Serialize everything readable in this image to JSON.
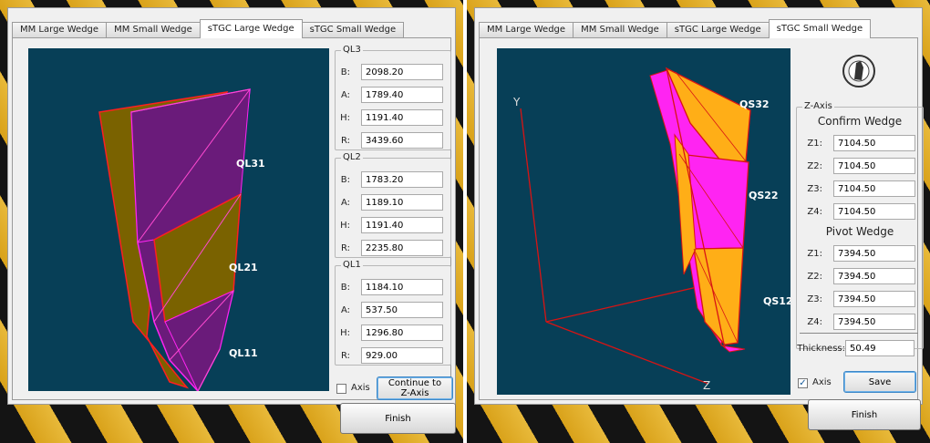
{
  "left": {
    "tabs": [
      "MM Large Wedge",
      "MM Small Wedge",
      "sTGC Large Wedge",
      "sTGC Small Wedge"
    ],
    "active_tab": "sTGC Large Wedge",
    "labels": [
      "QL31",
      "QL21",
      "QL11"
    ],
    "groups": [
      {
        "title": "QL3",
        "fields": [
          {
            "label": "B:",
            "value": "2098.20"
          },
          {
            "label": "A:",
            "value": "1789.40"
          },
          {
            "label": "H:",
            "value": "1191.40"
          },
          {
            "label": "R:",
            "value": "3439.60"
          }
        ]
      },
      {
        "title": "QL2",
        "fields": [
          {
            "label": "B:",
            "value": "1783.20"
          },
          {
            "label": "A:",
            "value": "1189.10"
          },
          {
            "label": "H:",
            "value": "1191.40"
          },
          {
            "label": "R:",
            "value": "2235.80"
          }
        ]
      },
      {
        "title": "QL1",
        "fields": [
          {
            "label": "B:",
            "value": "1184.10"
          },
          {
            "label": "A:",
            "value": "537.50"
          },
          {
            "label": "H:",
            "value": "1296.80"
          },
          {
            "label": "R:",
            "value": "929.00"
          }
        ]
      }
    ],
    "axis_label": "Axis",
    "axis_checked": false,
    "continue_button": "Continue to Z-Axis",
    "finish_button": "Finish"
  },
  "right": {
    "tabs": [
      "MM Large Wedge",
      "MM Small Wedge",
      "sTGC Large Wedge",
      "sTGC Small Wedge"
    ],
    "active_tab": "sTGC Small Wedge",
    "labels": [
      "QS32",
      "QS22",
      "QS12"
    ],
    "axis_letters": {
      "y": "Y",
      "z": "Z"
    },
    "zaxis_title": "Z-Axis",
    "confirm_heading": "Confirm Wedge",
    "confirm_fields": [
      {
        "label": "Z1:",
        "value": "7104.50"
      },
      {
        "label": "Z2:",
        "value": "7104.50"
      },
      {
        "label": "Z3:",
        "value": "7104.50"
      },
      {
        "label": "Z4:",
        "value": "7104.50"
      }
    ],
    "pivot_heading": "Pivot Wedge",
    "pivot_fields": [
      {
        "label": "Z1:",
        "value": "7394.50"
      },
      {
        "label": "Z2:",
        "value": "7394.50"
      },
      {
        "label": "Z3:",
        "value": "7394.50"
      },
      {
        "label": "Z4:",
        "value": "7394.50"
      }
    ],
    "thickness_label": "Thickness:",
    "thickness_value": "50.49",
    "axis_label": "Axis",
    "axis_checked": true,
    "save_button": "Save",
    "finish_button": "Finish",
    "logo_icon": "university-seal-icon"
  },
  "colors": {
    "viewport": "#073f57",
    "purple": "#6a1b7a",
    "olive": "#7a6200",
    "magenta": "#ff24f2",
    "orange": "#ffae17",
    "edge_red": "#ff1f1f"
  }
}
